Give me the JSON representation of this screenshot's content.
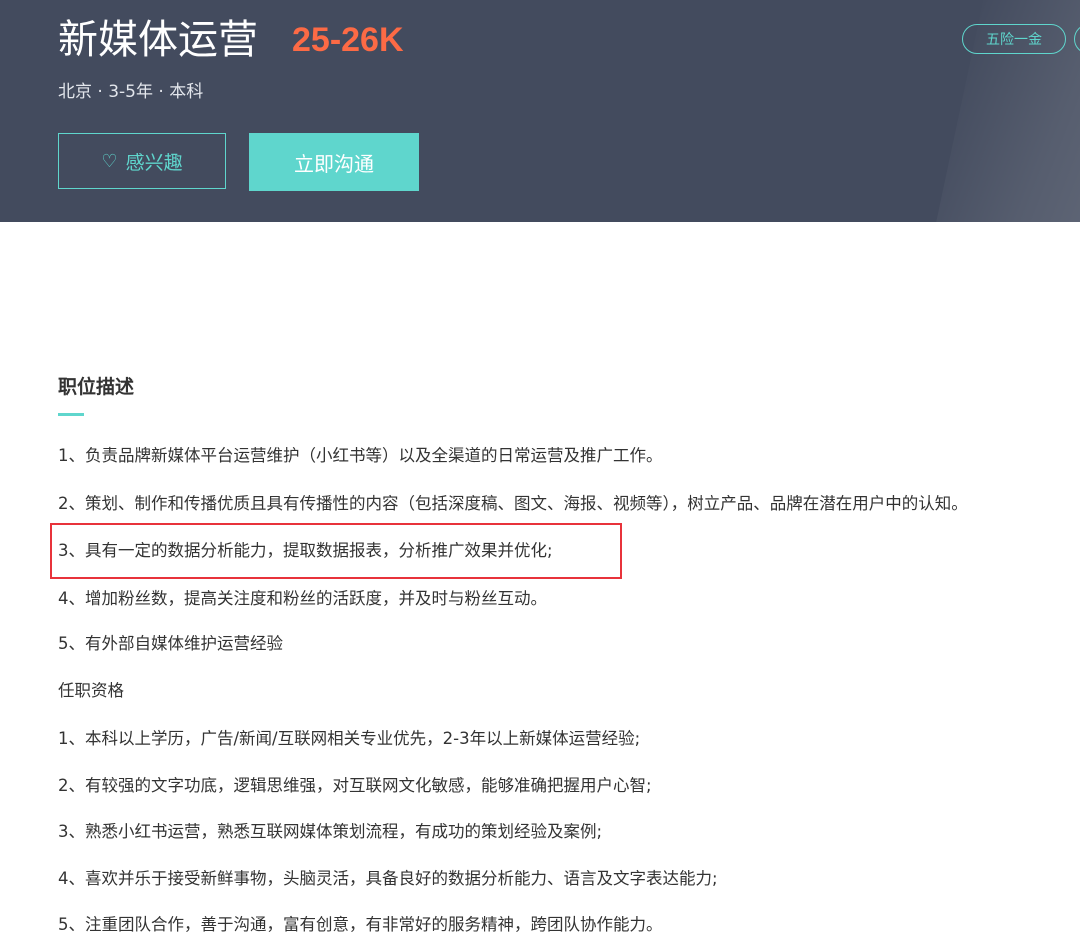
{
  "header": {
    "title": "新媒体运营",
    "salary": "25-26K",
    "meta": "北京 · 3-5年 · 本科",
    "interest_icon": "heart-outline-icon",
    "interest_label": "感兴趣",
    "chat_label": "立即沟通",
    "tags": [
      "五险一金"
    ],
    "colors": {
      "background": "#434b5e",
      "salary": "#fc6a45",
      "accent": "#5fd6cd"
    }
  },
  "description": {
    "title": "职位描述",
    "responsibilities": [
      "1、负责品牌新媒体平台运营维护（小红书等）以及全渠道的日常运营及推广工作。",
      "2、策划、制作和传播优质且具有传播性的内容（包括深度稿、图文、海报、视频等），树立产品、品牌在潜在用户中的认知。",
      "3、具有一定的数据分析能力，提取数据报表，分析推广效果并优化;",
      "4、增加粉丝数，提高关注度和粉丝的活跃度，并及时与粉丝互动。",
      "5、有外部自媒体维护运营经验"
    ],
    "qualifications_title": "任职资格",
    "qualifications": [
      "1、本科以上学历，广告/新闻/互联网相关专业优先，2-3年以上新媒体运营经验;",
      "2、有较强的文字功底，逻辑思维强，对互联网文化敏感，能够准确把握用户心智;",
      "3、熟悉小红书运营，熟悉互联网媒体策划流程，有成功的策划经验及案例;",
      "4、喜欢并乐于接受新鲜事物，头脑灵活，具备良好的数据分析能力、语言及文字表达能力;",
      "5、注重团队合作，善于沟通，富有创意，有非常好的服务精神，跨团队协作能力。"
    ],
    "highlight_color": "#e8333b"
  }
}
